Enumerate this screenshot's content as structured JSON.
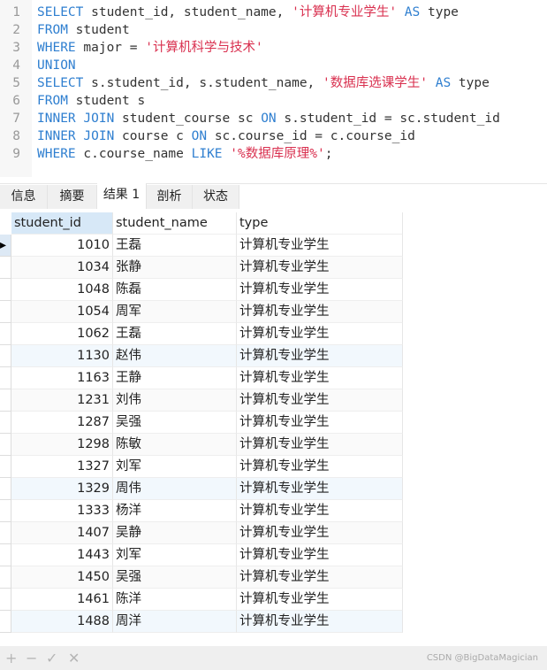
{
  "editor": {
    "lines": [
      [
        {
          "t": "SELECT",
          "c": "kw"
        },
        {
          "t": " student_id, student_name, "
        },
        {
          "t": "'计算机专业学生'",
          "c": "str"
        },
        {
          "t": " "
        },
        {
          "t": "AS",
          "c": "kw"
        },
        {
          "t": " type"
        }
      ],
      [
        {
          "t": "FROM",
          "c": "kw"
        },
        {
          "t": " student"
        }
      ],
      [
        {
          "t": "WHERE",
          "c": "kw"
        },
        {
          "t": " major = "
        },
        {
          "t": "'计算机科学与技术'",
          "c": "str"
        }
      ],
      [
        {
          "t": "UNION",
          "c": "kw"
        }
      ],
      [
        {
          "t": "SELECT",
          "c": "kw"
        },
        {
          "t": " s.student_id, s.student_name, "
        },
        {
          "t": "'数据库选课学生'",
          "c": "str"
        },
        {
          "t": " "
        },
        {
          "t": "AS",
          "c": "kw"
        },
        {
          "t": " type"
        }
      ],
      [
        {
          "t": "FROM",
          "c": "kw"
        },
        {
          "t": " student s"
        }
      ],
      [
        {
          "t": "INNER JOIN",
          "c": "kw"
        },
        {
          "t": " student_course sc "
        },
        {
          "t": "ON",
          "c": "kw"
        },
        {
          "t": " s.student_id = sc.student_id"
        }
      ],
      [
        {
          "t": "INNER JOIN",
          "c": "kw"
        },
        {
          "t": " course c "
        },
        {
          "t": "ON",
          "c": "kw"
        },
        {
          "t": " sc.course_id = c.course_id"
        }
      ],
      [
        {
          "t": "WHERE",
          "c": "kw"
        },
        {
          "t": " c.course_name "
        },
        {
          "t": "LIKE",
          "c": "kw"
        },
        {
          "t": " "
        },
        {
          "t": "'%数据库原理%'",
          "c": "str"
        },
        {
          "t": ";"
        }
      ]
    ]
  },
  "tabs": [
    {
      "label": "信息"
    },
    {
      "label": "摘要"
    },
    {
      "label": "结果 1",
      "active": true
    },
    {
      "label": "剖析"
    },
    {
      "label": "状态"
    }
  ],
  "grid": {
    "columns": [
      "student_id",
      "student_name",
      "type"
    ],
    "rows": [
      [
        "1010",
        "王磊",
        "计算机专业学生"
      ],
      [
        "1034",
        "张静",
        "计算机专业学生"
      ],
      [
        "1048",
        "陈磊",
        "计算机专业学生"
      ],
      [
        "1054",
        "周军",
        "计算机专业学生"
      ],
      [
        "1062",
        "王磊",
        "计算机专业学生"
      ],
      [
        "1130",
        "赵伟",
        "计算机专业学生"
      ],
      [
        "1163",
        "王静",
        "计算机专业学生"
      ],
      [
        "1231",
        "刘伟",
        "计算机专业学生"
      ],
      [
        "1287",
        "吴强",
        "计算机专业学生"
      ],
      [
        "1298",
        "陈敏",
        "计算机专业学生"
      ],
      [
        "1327",
        "刘军",
        "计算机专业学生"
      ],
      [
        "1329",
        "周伟",
        "计算机专业学生"
      ],
      [
        "1333",
        "杨洋",
        "计算机专业学生"
      ],
      [
        "1407",
        "吴静",
        "计算机专业学生"
      ],
      [
        "1443",
        "刘军",
        "计算机专业学生"
      ],
      [
        "1450",
        "吴强",
        "计算机专业学生"
      ],
      [
        "1461",
        "陈洋",
        "计算机专业学生"
      ],
      [
        "1488",
        "周洋",
        "计算机专业学生"
      ]
    ]
  },
  "toolbar": {
    "add": "+",
    "remove": "−",
    "apply": "✓",
    "cancel": "✕"
  },
  "watermark": "CSDN @BigDataMagician"
}
